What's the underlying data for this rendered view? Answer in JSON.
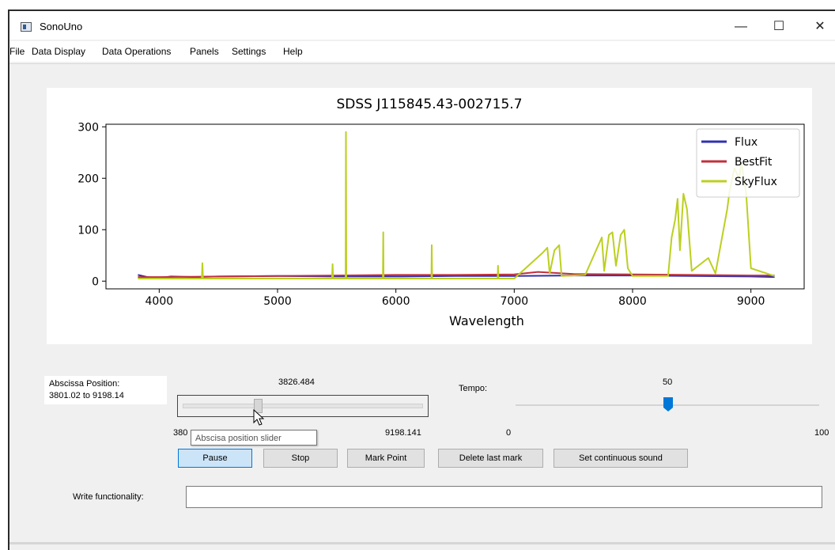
{
  "window": {
    "title": "SonoUno",
    "controls": {
      "minimize": "—",
      "maximize": "☐",
      "close": "✕"
    }
  },
  "menu": {
    "items": [
      "File",
      "Data Display",
      "Data Operations",
      "Panels",
      "Settings",
      "Help"
    ]
  },
  "chart_data": {
    "type": "line",
    "title": "SDSS J115845.43-002715.7",
    "xlabel": "Wavelength",
    "ylabel": "",
    "xlim": [
      3550,
      9450
    ],
    "ylim": [
      -15,
      305
    ],
    "xticks": [
      4000,
      5000,
      6000,
      7000,
      8000,
      9000
    ],
    "yticks": [
      0,
      100,
      200,
      300
    ],
    "legend_position": "upper right",
    "series": [
      {
        "name": "Flux",
        "color": "#3030b0",
        "x": [
          3820,
          3900,
          4000,
          4100,
          4300,
          4500,
          5000,
          5500,
          6000,
          6500,
          7000,
          7500,
          8000,
          8500,
          9000,
          9200
        ],
        "y": [
          12,
          8,
          6,
          9,
          8,
          9,
          10,
          9,
          9,
          10,
          10,
          11,
          11,
          10,
          9,
          8
        ]
      },
      {
        "name": "BestFit",
        "color": "#c0303c",
        "x": [
          3820,
          4000,
          4500,
          5000,
          5500,
          6000,
          6500,
          7000,
          7200,
          7500,
          8000,
          8500,
          9000,
          9200
        ],
        "y": [
          8,
          8,
          9,
          10,
          11,
          12,
          12,
          13,
          18,
          14,
          13,
          12,
          11,
          11
        ]
      },
      {
        "name": "SkyFlux",
        "color": "#bccf20",
        "x": [
          3820,
          4360,
          4365,
          4370,
          5000,
          5460,
          5465,
          5470,
          5575,
          5578,
          5581,
          5890,
          5893,
          5896,
          6300,
          6303,
          6306,
          6860,
          6863,
          6866,
          7000,
          7240,
          7280,
          7300,
          7340,
          7380,
          7400,
          7600,
          7740,
          7760,
          7800,
          7830,
          7860,
          7900,
          7930,
          7960,
          8000,
          8300,
          8330,
          8360,
          8380,
          8400,
          8430,
          8460,
          8500,
          8640,
          8700,
          8800,
          8820,
          8860,
          8900,
          8920,
          8960,
          9000,
          9200
        ],
        "y": [
          5,
          5,
          35,
          5,
          5,
          5,
          33,
          5,
          5,
          290,
          5,
          5,
          95,
          5,
          5,
          70,
          5,
          5,
          30,
          5,
          5,
          55,
          65,
          15,
          60,
          70,
          10,
          12,
          85,
          20,
          90,
          95,
          30,
          90,
          100,
          25,
          10,
          10,
          85,
          120,
          160,
          60,
          170,
          140,
          20,
          45,
          15,
          140,
          175,
          220,
          200,
          230,
          170,
          25,
          10
        ]
      }
    ]
  },
  "controls": {
    "abscissa_label": "Abscissa Position:",
    "abscissa_range": "3801.02 to 9198.14",
    "slider_value": "3826.484",
    "slider_min_label": "380",
    "slider_max_label": "9198.141",
    "slider_position": 0.31,
    "slider_tooltip": "Abscisa position slider",
    "tempo_label": "Tempo:",
    "tempo_value": "50",
    "tempo_min": "0",
    "tempo_max": "100",
    "buttons": {
      "pause": "Pause",
      "stop": "Stop",
      "mark_point": "Mark Point",
      "delete_mark": "Delete last mark",
      "continuous": "Set continuous sound"
    },
    "write_label": "Write functionality:",
    "write_value": ""
  }
}
